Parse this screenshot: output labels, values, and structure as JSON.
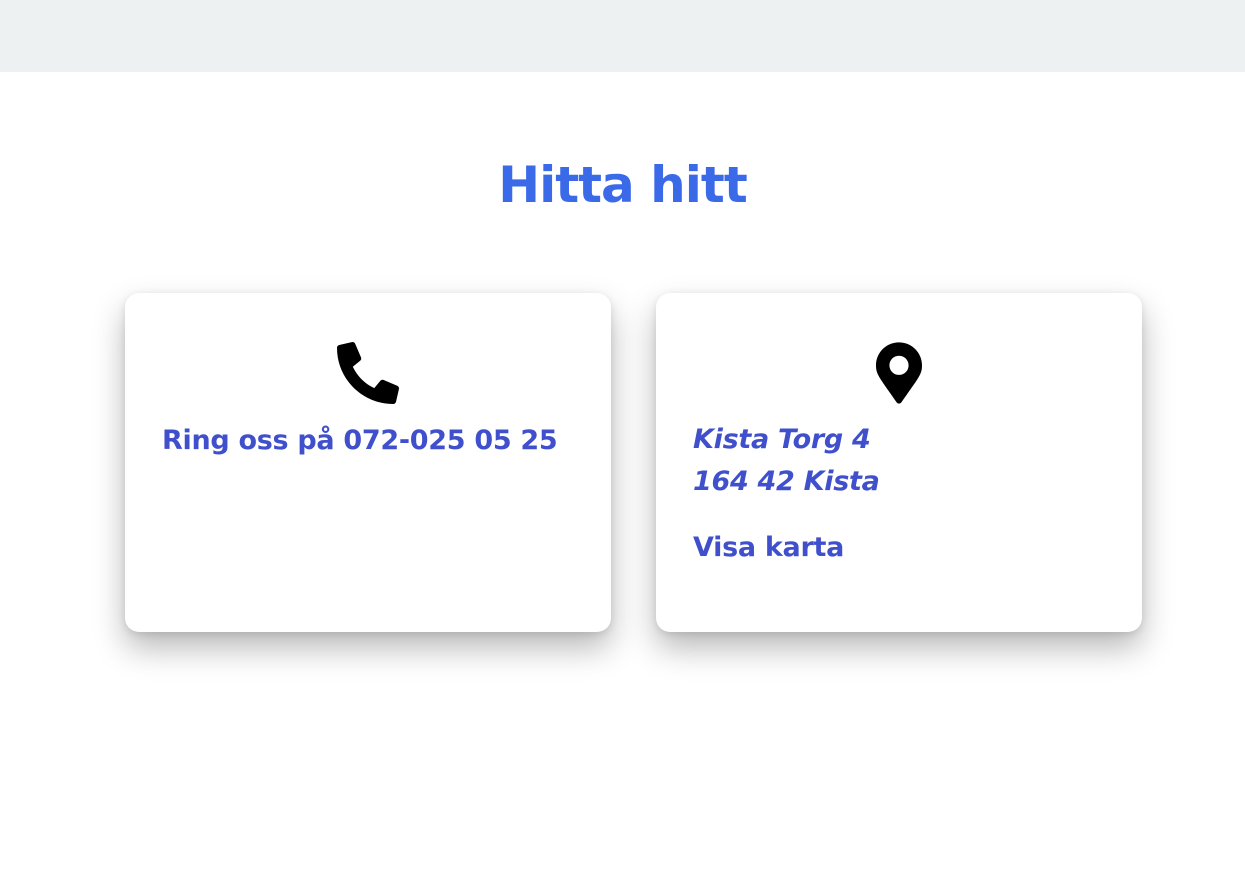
{
  "colors": {
    "heading": "#3b6ae8",
    "card_text": "#4050cc",
    "icon": "#000000",
    "topbar": "#edf1f2"
  },
  "section": {
    "title": "Hitta hitt"
  },
  "phone_card": {
    "icon": "phone-icon",
    "text": "Ring oss på 072-025 05 25"
  },
  "address_card": {
    "icon": "map-marker-icon",
    "street": "Kista Torg 4",
    "postal": "164 42 Kista",
    "map_link": "Visa karta"
  }
}
